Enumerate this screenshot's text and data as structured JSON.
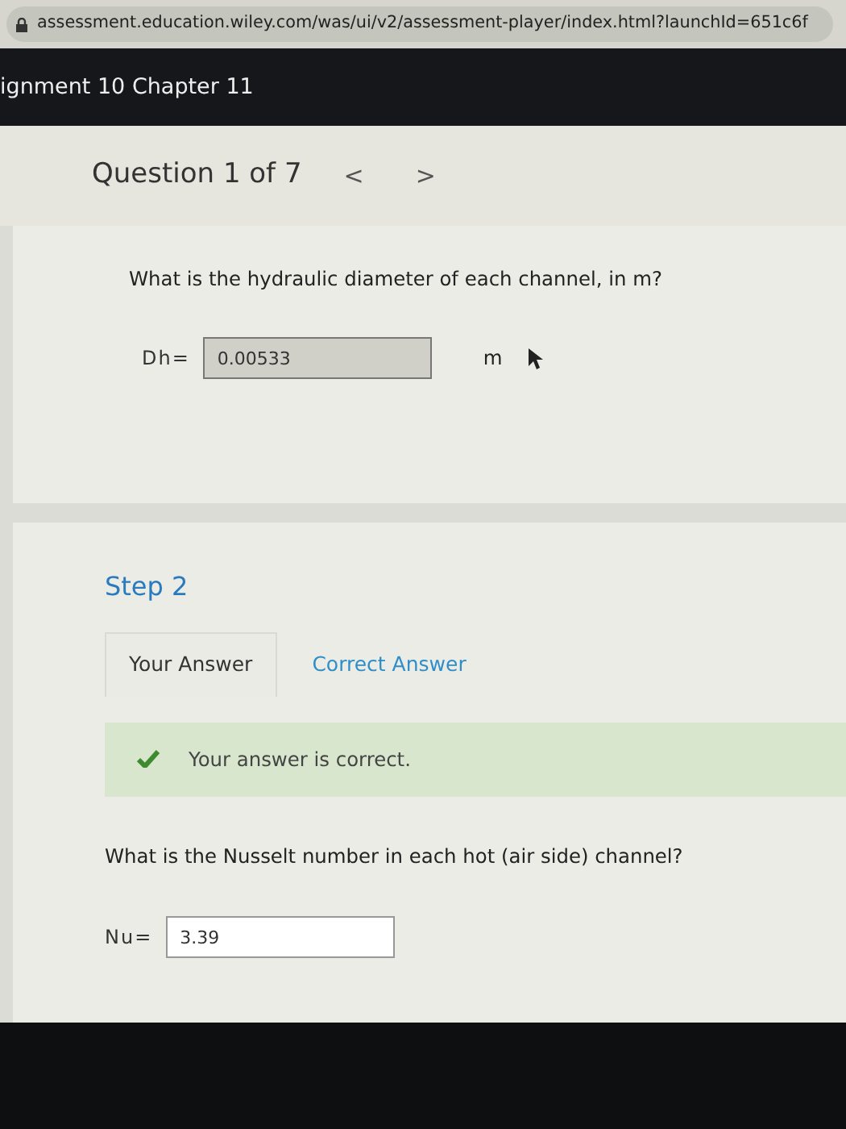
{
  "address_bar": {
    "url": "assessment.education.wiley.com/was/ui/v2/assessment-player/index.html?launchId=651c6f"
  },
  "header": {
    "title": "ignment 10 Chapter 11"
  },
  "question_nav": {
    "label": "Question 1 of 7",
    "prev": "<",
    "next": ">"
  },
  "step1": {
    "question": "What is the hydraulic diameter of each channel, in m?",
    "field": {
      "label": "Dh=",
      "value": "0.00533",
      "unit": "m",
      "disabled": true
    }
  },
  "step2": {
    "title": "Step 2",
    "tabs": [
      {
        "label": "Your Answer",
        "selected": true
      },
      {
        "label": "Correct Answer",
        "selected": false
      }
    ],
    "feedback": {
      "text": "Your answer is correct.",
      "correct": true
    },
    "question": "What is the Nusselt number in each hot (air side) channel?",
    "field": {
      "label": "Nu=",
      "value": "3.39",
      "disabled": false
    }
  }
}
